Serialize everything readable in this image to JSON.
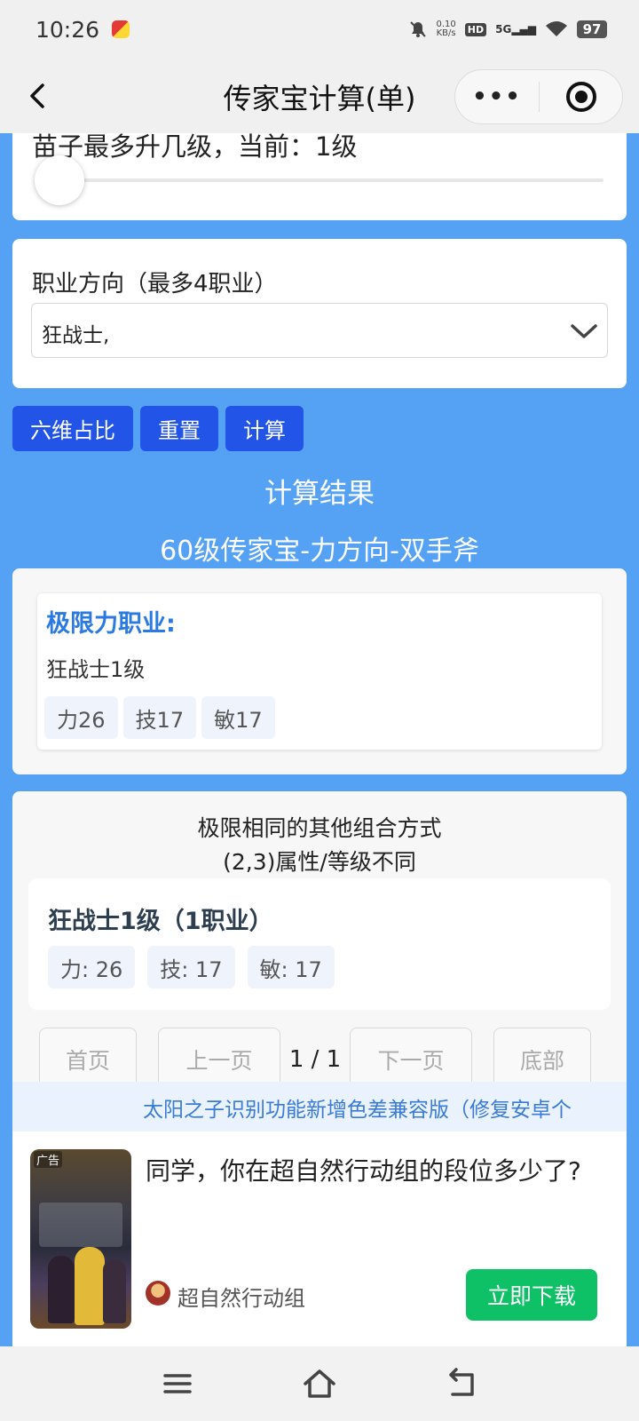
{
  "status_bar": {
    "time": "10:26",
    "net_speed_value": "0.10",
    "net_speed_unit": "KB/s",
    "hd": "HD",
    "signal": "5G",
    "battery": "97"
  },
  "nav": {
    "title": "传家宝计算(单)",
    "more_label": "•••"
  },
  "slider": {
    "label": "苗子最多升几级，当前：1级",
    "value": 1
  },
  "career": {
    "label": "职业方向（最多4职业）",
    "selected": "狂战士,"
  },
  "buttons": {
    "ratio": "六维占比",
    "reset": "重置",
    "calc": "计算"
  },
  "result": {
    "title": "计算结果",
    "subtitle": "60级传家宝-力方向-双手斧",
    "limit_heading": "极限力职业:",
    "limit_level": "狂战士1级",
    "limit_stats": [
      "力26",
      "技17",
      "敏17"
    ]
  },
  "others": {
    "title_line1": "极限相同的其他组合方式",
    "title_line2": "(2,3)属性/等级不同",
    "combo_title": "狂战士1级（1职业）",
    "combo_stats": [
      "力: 26",
      "技: 17",
      "敏: 17"
    ]
  },
  "pager": {
    "first": "首页",
    "prev": "上一页",
    "page": "1 / 1",
    "next": "下一页",
    "bottom": "底部"
  },
  "marquee": "太阳之子识别功能新增色差兼容版（修复安卓个",
  "ad": {
    "tag": "广告",
    "headline": "同学，你在超自然行动组的段位多少了?",
    "brand": "超自然行动组",
    "download": "立即下载"
  },
  "colors": {
    "page_bg": "#55a2f5",
    "button_blue": "#2254e8",
    "heading_blue": "#2a7ae2",
    "download_green": "#0ec166"
  }
}
